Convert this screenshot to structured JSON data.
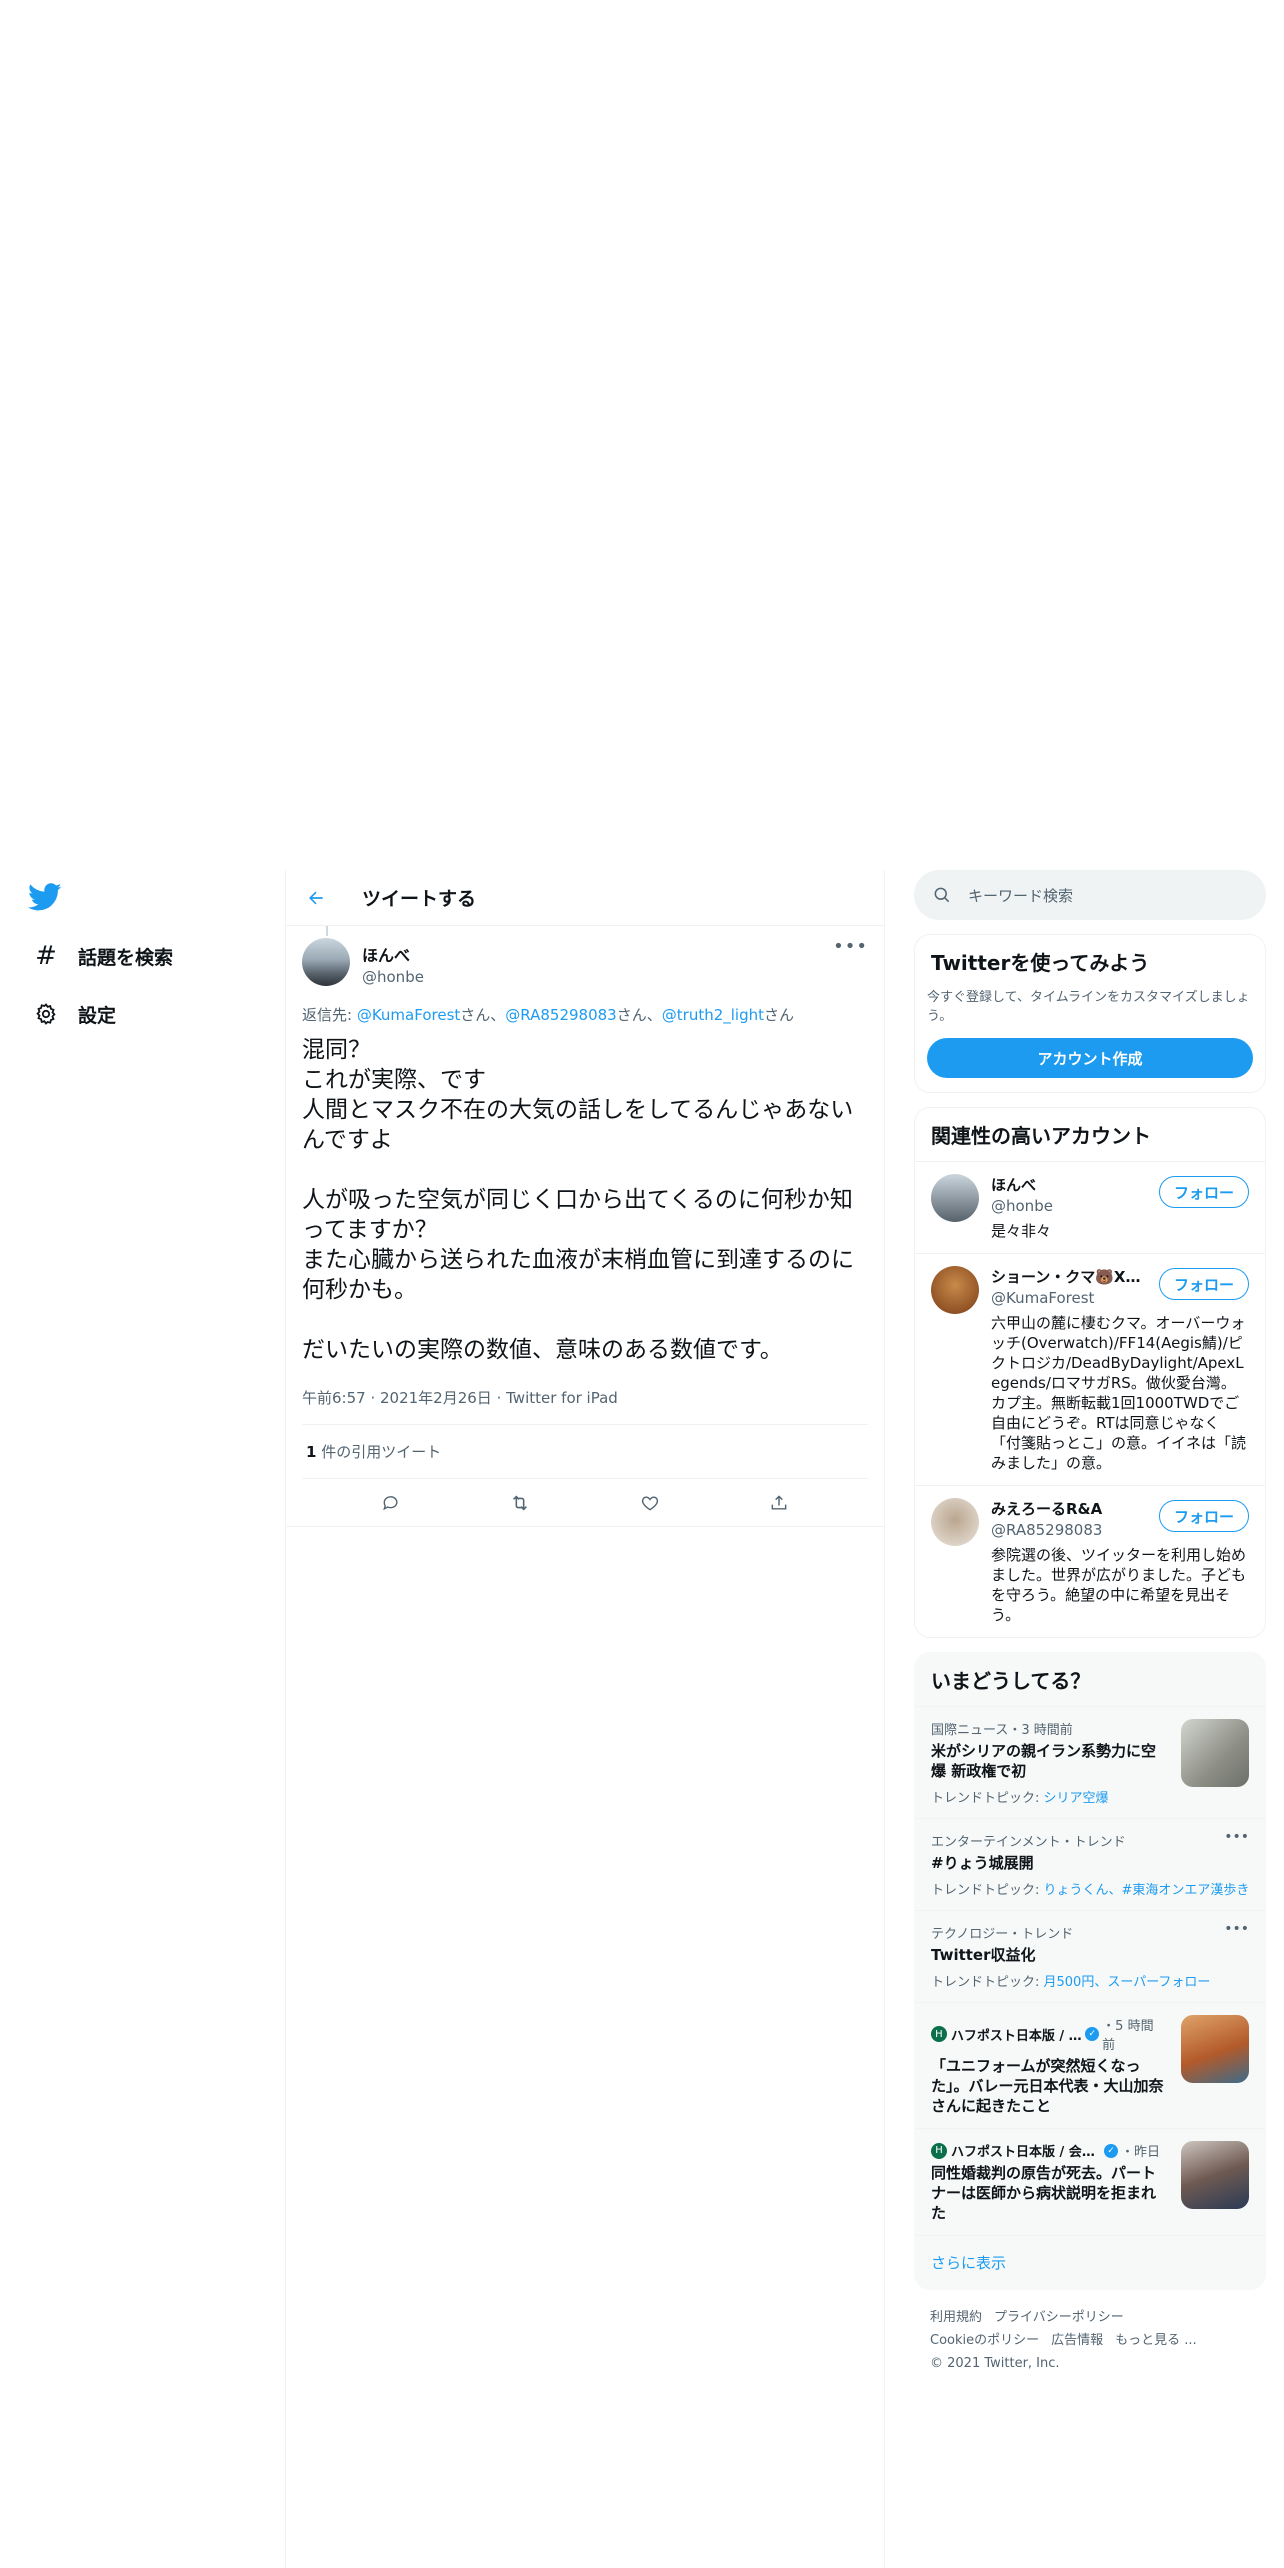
{
  "nav": {
    "items": [
      {
        "label": "話題を検索",
        "icon": "hashtag-icon"
      },
      {
        "label": "設定",
        "icon": "gear-icon"
      }
    ]
  },
  "header": {
    "title": "ツイートする"
  },
  "tweet": {
    "name": "ほんべ",
    "handle": "@honbe",
    "reply_prefix": "返信先: ",
    "mentions": [
      "@KumaForest",
      "@RA85298083",
      "@truth2_light"
    ],
    "mention_suffix": "さん",
    "separator": "、",
    "text": "混同？\nこれが実際、です\n人間とマスク不在の大気の話しをしてるんじゃあないんですよ\n\n人が吸った空気が同じく口から出てくるのに何秒か知ってますか？\nまた心臓から送られた血液が末梢血管に到達するのに何秒かも。\n\nだいたいの実際の数値、意味のある数値です。",
    "time": "午前6:57",
    "date": "2021年2月26日",
    "client": "Twitter for iPad",
    "quote_count": "1",
    "quote_label": " 件の引用ツイート"
  },
  "search": {
    "placeholder": "キーワード検索"
  },
  "signup": {
    "title": "Twitterを使ってみよう",
    "desc": "今すぐ登録して、タイムラインをカスタマイズしましょう。",
    "button": "アカウント作成"
  },
  "related": {
    "title": "関連性の高いアカウント",
    "follow_label": "フォロー",
    "accounts": [
      {
        "name": "ほんべ",
        "handle": "@honbe",
        "bio": "是々非々",
        "color": "#8d9aa5"
      },
      {
        "name": "ショーン・クマ🐻Xi...",
        "handle": "@KumaForest",
        "bio": "六甲山の麓に棲むクマ。オーバーウォッチ(Overwatch)/FF14(Aegis鯖)/ピクトロジカ/DeadByDaylight/ApexLegends/ロマサガRS。做伙愛台灣。カプ主。無断転載1回1000TWDでご自由にどうぞ。RTは同意じゃなく「付箋貼っとこ」の意。イイネは「読みました」の意。",
        "color": "#a0632c"
      },
      {
        "name": "みえろーるR&A",
        "handle": "@RA85298083",
        "bio": "参院選の後、ツイッターを利用し始めました。世界が広がりました。子どもを守ろう。絶望の中に希望を見出そう。",
        "color": "#d9cfc4"
      }
    ]
  },
  "trends": {
    "title": "いまどうしてる？",
    "items": [
      {
        "context": "国際ニュース・3 時間前",
        "title": "米がシリアの親イラン系勢力に空爆 新政権で初",
        "topic_label": "トレンドトピック: ",
        "topics": "シリア空爆",
        "thumb": "#9fa39a"
      },
      {
        "context": "エンターテインメント・トレンド",
        "title": "#りょう城展開",
        "topic_label": "トレンドトピック: ",
        "topics": "りょうくん、#東海オンエア漢歩き"
      },
      {
        "context": "テクノロジー・トレンド",
        "title": "Twitter収益化",
        "topic_label": "トレンドトピック: ",
        "topics": "月500円、スーパーフォロー"
      },
      {
        "source": "ハフポスト日本版 / ...",
        "time": "・5 時間前",
        "title": "「ユニフォームが突然短くなった」。バレー元日本代表・大山加奈さんに起きたこと",
        "thumb": "#c97a3a"
      },
      {
        "source": "ハフポスト日本版 / 会話...",
        "time": "・昨日",
        "title": "同性婚裁判の原告が死去。パートナーは医師から病状説明を拒まれた",
        "thumb": "#5a4a44"
      }
    ],
    "show_more": "さらに表示"
  },
  "footer": {
    "links": [
      "利用規約",
      "プライバシーポリシー",
      "Cookieのポリシー",
      "広告情報",
      "もっと見る ..."
    ],
    "copyright": "© 2021 Twitter, Inc."
  },
  "colors": {
    "accent": "#1d9bf0",
    "text": "#0f1419",
    "muted": "#536471"
  }
}
